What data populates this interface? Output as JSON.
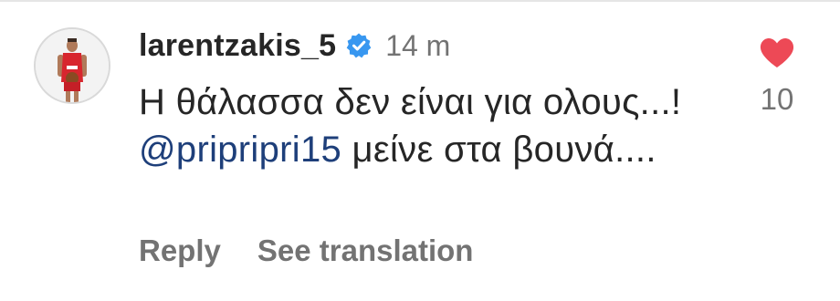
{
  "comment": {
    "username": "larentzakis_5",
    "verified_icon": "verified-badge-icon",
    "timestamp": "14 m",
    "text_part1": "Η θάλασσα δεν είναι για ολους...! ",
    "mention": "@pripripri15",
    "text_part2": " μείνε στα βουνά....",
    "like_icon": "heart-icon",
    "like_count": "10",
    "actions": {
      "reply": "Reply",
      "see_translation": "See translation"
    }
  },
  "colors": {
    "heart": "#ed4956",
    "verified": "#3897f0",
    "mention": "#1e3f7a",
    "muted": "#737373"
  }
}
